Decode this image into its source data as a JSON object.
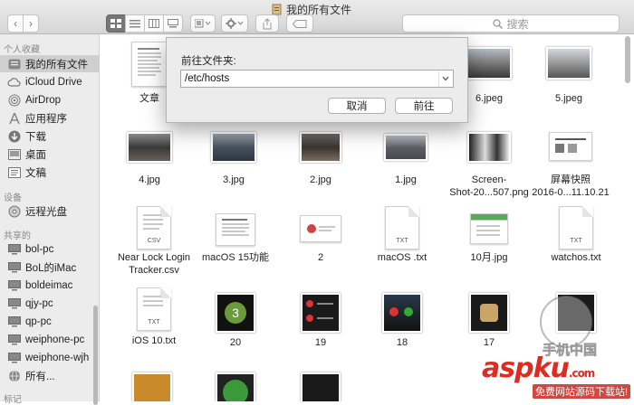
{
  "window": {
    "title": "我的所有文件"
  },
  "toolbar": {
    "search_placeholder": "搜索"
  },
  "sidebar": {
    "favorites_header": "个人收藏",
    "favorites": [
      {
        "label": "我的所有文件",
        "icon": "all-files-icon",
        "selected": true
      },
      {
        "label": "iCloud Drive",
        "icon": "cloud-icon"
      },
      {
        "label": "AirDrop",
        "icon": "airdrop-icon"
      },
      {
        "label": "应用程序",
        "icon": "applications-icon"
      },
      {
        "label": "下载",
        "icon": "download-icon"
      },
      {
        "label": "桌面",
        "icon": "desktop-icon"
      },
      {
        "label": "文稿",
        "icon": "documents-icon"
      }
    ],
    "devices_header": "设备",
    "devices": [
      {
        "label": "远程光盘",
        "icon": "disc-icon"
      }
    ],
    "shared_header": "共享的",
    "shared": [
      {
        "label": "bol-pc",
        "icon": "computer-icon"
      },
      {
        "label": "BoL的iMac",
        "icon": "computer-icon"
      },
      {
        "label": "boldeimac",
        "icon": "computer-icon"
      },
      {
        "label": "qjy-pc",
        "icon": "computer-icon"
      },
      {
        "label": "qp-pc",
        "icon": "computer-icon"
      },
      {
        "label": "weiphone-pc",
        "icon": "computer-icon"
      },
      {
        "label": "weiphone-wjh",
        "icon": "computer-icon"
      },
      {
        "label": "所有...",
        "icon": "globe-icon"
      }
    ],
    "tags_header": "标记"
  },
  "dialog": {
    "label": "前往文件夹:",
    "value": "/etc/hosts",
    "cancel": "取消",
    "go": "前往"
  },
  "files": {
    "row1": [
      "文章",
      "6.jpeg",
      "5.jpeg"
    ],
    "row2": [
      "4.jpg",
      "3.jpg",
      "2.jpg",
      "1.jpg",
      "Screen-\nShot-20...507.png",
      "屏幕快照\n2016-0...11.10.21"
    ],
    "row3": [
      "Near Lock Login\nTracker.csv",
      "macOS 15功能",
      "2",
      "macOS .txt",
      "10月.jpg",
      "watchos.txt"
    ],
    "row4": [
      "iOS 10.txt",
      "20",
      "19",
      "18",
      "17"
    ]
  },
  "watermark": {
    "brand": "aspku",
    "domain": ".com",
    "slogan": "免费网站源码下载站!",
    "site": "手机中国"
  }
}
